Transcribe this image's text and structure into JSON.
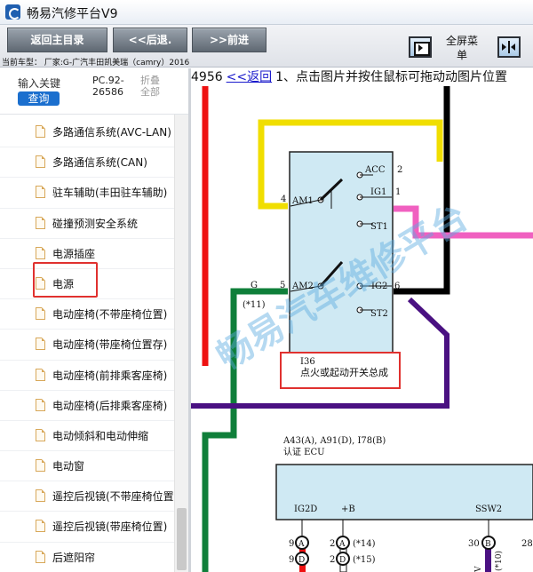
{
  "window": {
    "title": "畅易汽修平台V9"
  },
  "toolbar": {
    "home_label": "返回主目录",
    "back_label": "<<后退.",
    "forward_label": ">>前进",
    "fullscreen_label": "全屏菜单",
    "vehicle_info": "当前车型： 厂家:G-广汽丰田凯美瑞（camry）2016"
  },
  "sidebar": {
    "search_label": "输入关键",
    "search_button": "查询",
    "pc_code": "PC.92-26586",
    "collapse_all": "折叠全部",
    "items": [
      {
        "label": "多路通信系统(AVC-LAN)"
      },
      {
        "label": "多路通信系统(CAN)"
      },
      {
        "label": "驻车辅助(丰田驻车辅助)"
      },
      {
        "label": "碰撞预测安全系统"
      },
      {
        "label": "电源插座"
      },
      {
        "label": "电源"
      },
      {
        "label": "电动座椅(不带座椅位置)"
      },
      {
        "label": "电动座椅(带座椅位置存)"
      },
      {
        "label": "电动座椅(前排乘客座椅)"
      },
      {
        "label": "电动座椅(后排乘客座椅)"
      },
      {
        "label": "电动倾斜和电动伸缩"
      },
      {
        "label": "电动窗"
      },
      {
        "label": "遥控后视镜(不带座椅位置)"
      },
      {
        "label": "遥控后视镜(带座椅位置)"
      },
      {
        "label": "后遮阳帘"
      }
    ],
    "selected_item": "电源"
  },
  "viewer": {
    "page_code": "4956",
    "back_link": "<<返回",
    "instruction": "1、点击图片并按住鼠标可拖动动图片位置"
  },
  "diagram": {
    "watermark": "畅易汽车维修平台",
    "switch": {
      "pins": {
        "am1": "AM1",
        "am2": "AM2",
        "acc": "ACC",
        "ig1": "IG1",
        "st1": "ST1",
        "ig2": "IG2",
        "st2": "ST2"
      },
      "pin_numbers": {
        "am1": "4",
        "am2": "5",
        "acc": "2",
        "ig1": "1",
        "ig2": "6"
      },
      "code": "I36",
      "name": "点火或起动开关总成"
    },
    "wire_labels": {
      "g": "G",
      "g_note": "(*11)"
    },
    "ecu": {
      "codes": "A43(A), A91(D), I78(B)",
      "name": "认证 ECU",
      "pins": {
        "ig2d": "IG2D",
        "plusb": "+B",
        "ssw2": "SSW2"
      },
      "pin_numbers": {
        "n9a": "9",
        "n9d": "9",
        "n2a": "2",
        "n2d": "2",
        "n30": "30",
        "n28": "28"
      },
      "connector_letters": {
        "a": "A",
        "d": "D",
        "b": "B"
      },
      "notes": {
        "n14": "(*14)",
        "n15": "(*15)",
        "n10": "(*10)"
      },
      "side_labels": {
        "v": "V"
      }
    },
    "colors": {
      "red": "#ee1111",
      "yellow": "#f0de00",
      "pink": "#f060c0",
      "black": "#000000",
      "green": "#0f7f3a",
      "purple": "#4a1182",
      "switch_fill": "#cfe9f3",
      "ecu_fill": "#cfe9f3",
      "highlight": "#e0312f"
    }
  }
}
